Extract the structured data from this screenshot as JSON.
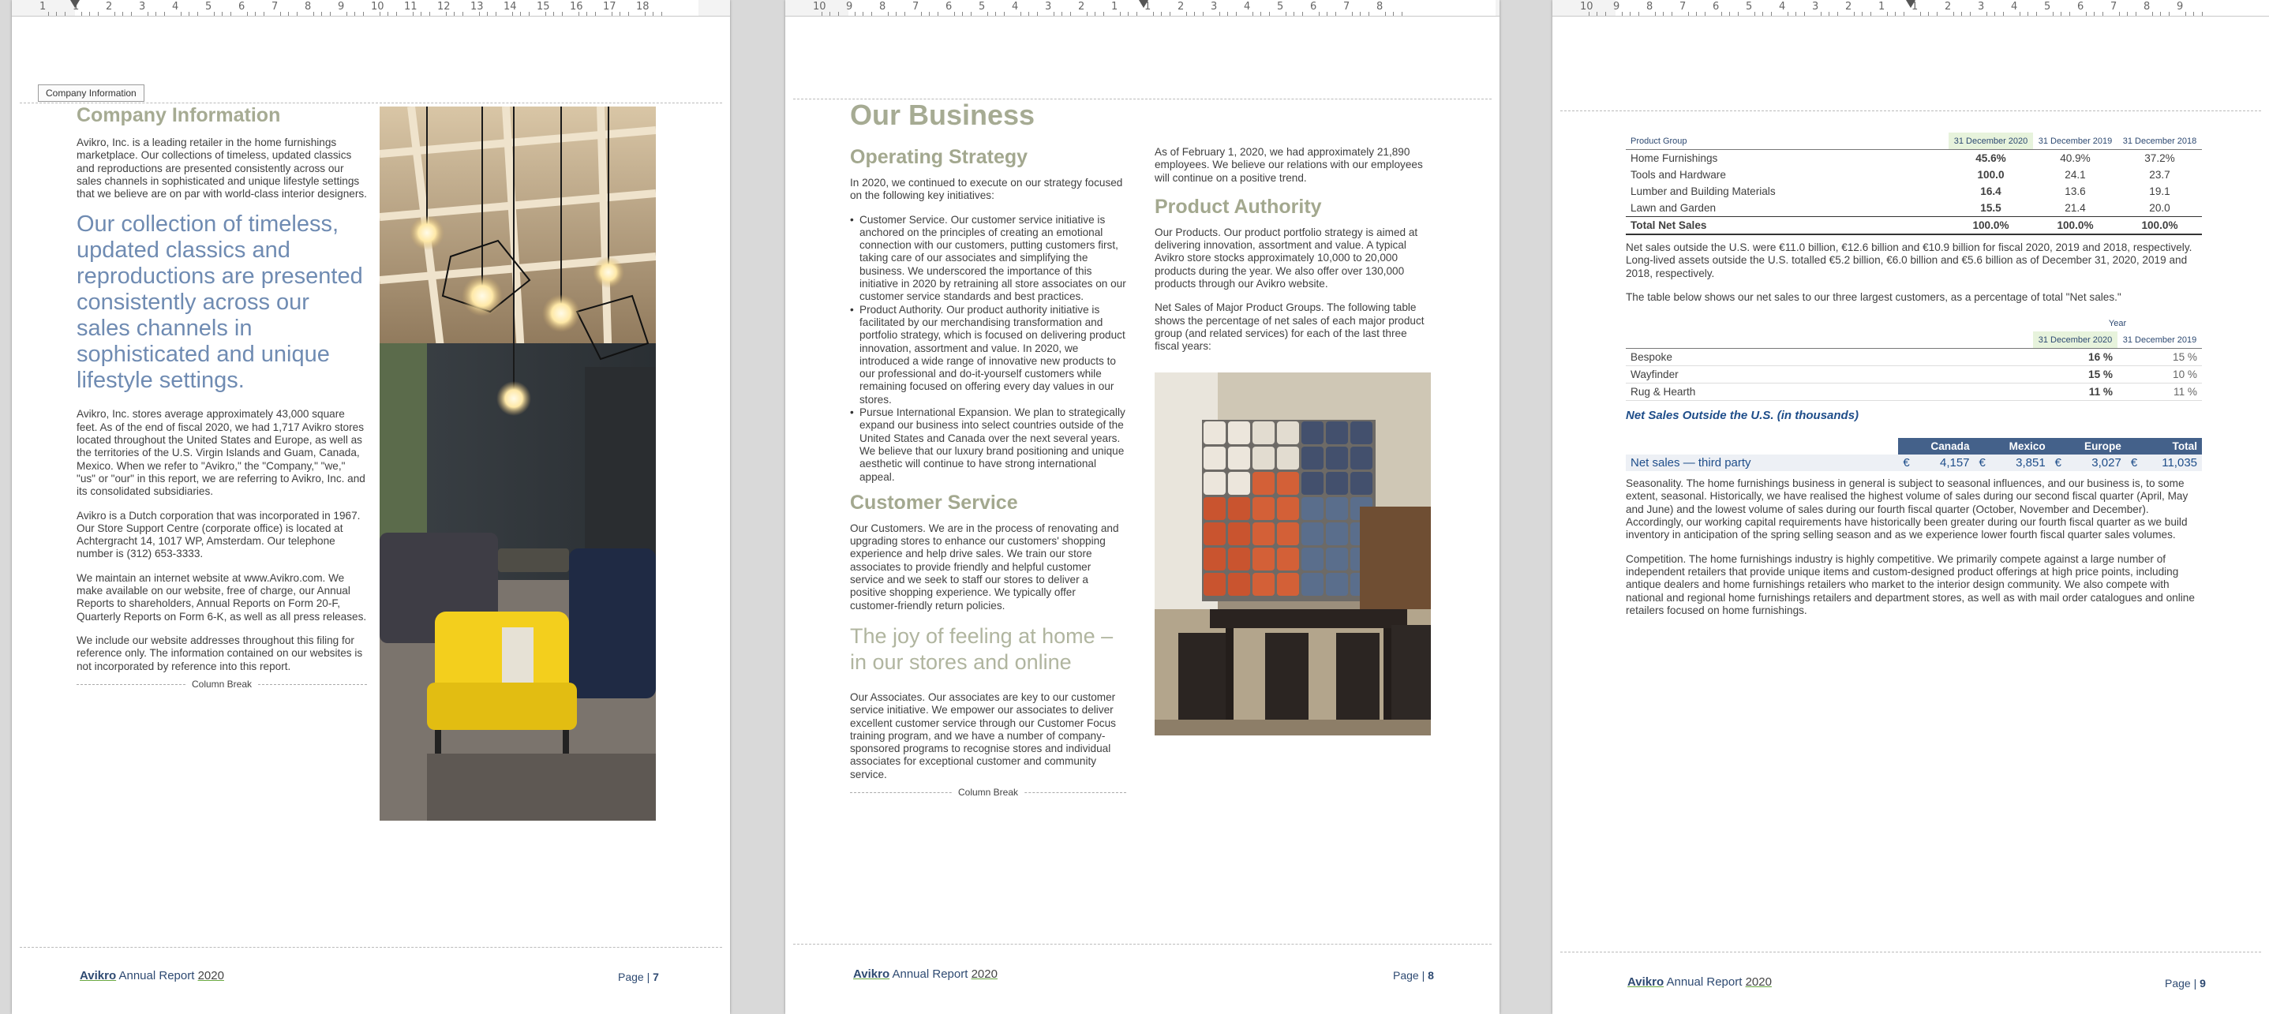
{
  "colors": {
    "olive_heading": "#a6ab93",
    "blue_quote": "#6f8bb2",
    "navy": "#2e4a72",
    "table_header": "#44618a"
  },
  "page1": {
    "ruler_numbers": [
      "1",
      "1",
      "2",
      "3",
      "4",
      "5",
      "6",
      "7",
      "8",
      "9",
      "10",
      "11",
      "12",
      "13",
      "14",
      "15",
      "16",
      "17",
      "18"
    ],
    "tag": "Company Information",
    "title": "Company Information",
    "p1": "Avikro, Inc. is a leading retailer in the home furnishings marketplace. Our collections of timeless, updated classics and reproductions are presented consistently across our sales channels in sophisticated and unique lifestyle settings that we believe are on par with world-class interior designers.",
    "quote": "Our collection of timeless, updated classics and reproductions are presented consistently across our sales channels in sophisticated and unique lifestyle settings.",
    "p2": "Avikro, Inc. stores average approximately 43,000 square feet. As of the end of fiscal 2020, we had 1,717 Avikro stores located throughout the United States and Europe, as well as the territories of the U.S. Virgin Islands and Guam, Canada, Mexico. When we refer to \"Avikro,\" the \"Company,\" \"we,\" \"us\" or \"our\" in this report, we are referring to Avikro, Inc. and its consolidated subsidiaries.",
    "p3": "Avikro is a Dutch corporation that was incorporated in 1967. Our Store Support Centre (corporate office) is located at Achtergracht 14, 1017 WP, Amsterdam. Our telephone number is (312) 653-3333.",
    "p4": "We maintain an internet website at www.Avikro.com. We make available on our website, free of charge, our Annual Reports to shareholders, Annual Reports on Form 20-F, Quarterly Reports on Form 6-K, as well as all press releases.",
    "p5": "We include our website addresses throughout this filing for reference only. The information contained on our websites is not incorporated by reference into this report.",
    "column_break": "Column Break",
    "footer_brand": "Avikro",
    "footer_text": "Annual Report",
    "footer_year": "2020",
    "footer_page_label": "Page |",
    "footer_page_num": "7"
  },
  "page2": {
    "ruler_numbers": [
      "10",
      "9",
      "8",
      "7",
      "6",
      "5",
      "4",
      "3",
      "2",
      "1",
      "1",
      "2",
      "3",
      "4",
      "5",
      "6",
      "7",
      "8"
    ],
    "title": "Our Business",
    "h_strategy": "Operating Strategy",
    "strategy_intro": "In 2020, we continued to execute on our strategy focused on the following key initiatives:",
    "bullets": [
      "Customer Service. Our customer service initiative is anchored on the principles of creating an emotional connection with our customers, putting customers first, taking care of our associates and simplifying the business. We underscored the importance of this initiative in 2020 by retraining all store associates on our customer service standards and best practices.",
      "Product Authority. Our product authority initiative is facilitated by our merchandising transformation and portfolio strategy, which is focused on delivering product innovation, assortment and value. In 2020, we introduced a wide range of innovative new products to our professional and do-it-yourself customers while remaining focused on offering every day values in our stores.",
      "Pursue International Expansion. We plan to strategically expand our business into select countries outside of the United States and Canada over the next several years. We believe that our luxury brand positioning and unique aesthetic will continue to have strong international appeal."
    ],
    "h_service": "Customer Service",
    "service_p": "Our Customers. We are in the process of renovating and upgrading stores to enhance our customers' shopping experience and help drive sales. We train our store associates to provide friendly and helpful customer service and we seek to staff our stores to deliver a positive shopping experience. We typically offer customer-friendly return policies.",
    "quote": "The joy of feeling at home – in our stores and online",
    "associates_p": "Our Associates. Our associates are key to our customer service initiative. We empower our associates to deliver excellent customer service through our Customer Focus training program, and we have a number of company-sponsored programs to recognise stores and individual associates for exceptional customer and community service.",
    "column_break": "Column Break",
    "right_p1": "As of February 1, 2020, we had approximately 21,890 employees. We believe our relations with our employees will continue on a positive trend.",
    "h_authority": "Product Authority",
    "right_p2": "Our Products. Our product portfolio strategy is aimed at delivering innovation, assortment and value. A typical Avikro store stocks approximately 10,000 to 20,000 products during the year. We also offer over 130,000 products through our Avikro website.",
    "right_p3": "Net Sales of Major Product Groups. The following table shows the percentage of net sales of each major product group (and related services) for each of the last three fiscal years:",
    "footer_brand": "Avikro",
    "footer_text": "Annual Report",
    "footer_year": "2020",
    "footer_page_label": "Page |",
    "footer_page_num": "8"
  },
  "page3": {
    "ruler_numbers": [
      "10",
      "9",
      "8",
      "7",
      "6",
      "5",
      "4",
      "3",
      "2",
      "1",
      "1",
      "2",
      "3",
      "4",
      "5",
      "6",
      "7",
      "8",
      "9"
    ],
    "product_table": {
      "headers": [
        "Product Group",
        "31 December 2020",
        "31 December 2019",
        "31 December 2018"
      ],
      "rows": [
        [
          "Home Furnishings",
          "45.6%",
          "40.9%",
          "37.2%"
        ],
        [
          "Tools and Hardware",
          "100.0",
          "24.1",
          "23.7"
        ],
        [
          "Lumber and Building Materials",
          "16.4",
          "13.6",
          "19.1"
        ],
        [
          "Lawn and Garden",
          "15.5",
          "21.4",
          "20.0"
        ],
        [
          "Total Net Sales",
          "100.0%",
          "100.0%",
          "100.0%"
        ]
      ]
    },
    "p1": "Net sales outside the U.S. were €11.0 billion, €12.6 billion and €10.9 billion for fiscal 2020, 2019 and 2018, respectively. Long-lived assets outside the U.S. totalled €5.2 billion, €6.0 billion and €5.6 billion as of December 31, 2020, 2019 and 2018, respectively.",
    "p2": "The table below shows our net sales to our three largest customers, as a percentage of total \"Net sales.\"",
    "customer_table": {
      "year_label": "Year",
      "headers": [
        "31 December 2020",
        "31 December 2019"
      ],
      "rows": [
        [
          "Bespoke",
          "16 %",
          "15 %"
        ],
        [
          "Wayfinder",
          "15 %",
          "10 %"
        ],
        [
          "Rug & Hearth",
          "11 %",
          "11 %"
        ]
      ]
    },
    "ns_title": "Net Sales Outside the U.S. (in thousands)",
    "ns_table": {
      "headers": [
        "Canada",
        "Mexico",
        "Europe",
        "Total"
      ],
      "row_label": "Net sales — third party",
      "currency": "€",
      "values": [
        "4,157",
        "3,851",
        "3,027",
        "11,035"
      ]
    },
    "p3": "Seasonality. The home furnishings business in general is subject to seasonal influences, and our business is, to some extent, seasonal. Historically, we have realised the highest volume of sales during our second fiscal quarter (April, May and June) and the lowest volume of sales during our fourth fiscal quarter (October, November and December). Accordingly, our working capital requirements have historically been greater during our fourth fiscal quarter as we build inventory in anticipation of the spring selling season and as we experience lower fourth fiscal quarter sales volumes.",
    "p4": "Competition. The home furnishings industry is highly competitive. We primarily compete against a large number of independent retailers that provide unique items and custom-designed product offerings at high price points, including antique dealers and home furnishings retailers who market to the interior design community. We also compete with national and regional home furnishings retailers and department stores, as well as with mail order catalogues and online retailers focused on home furnishings.",
    "footer_brand": "Avikro",
    "footer_text": "Annual Report",
    "footer_year": "2020",
    "footer_page_label": "Page |",
    "footer_page_num": "9"
  }
}
